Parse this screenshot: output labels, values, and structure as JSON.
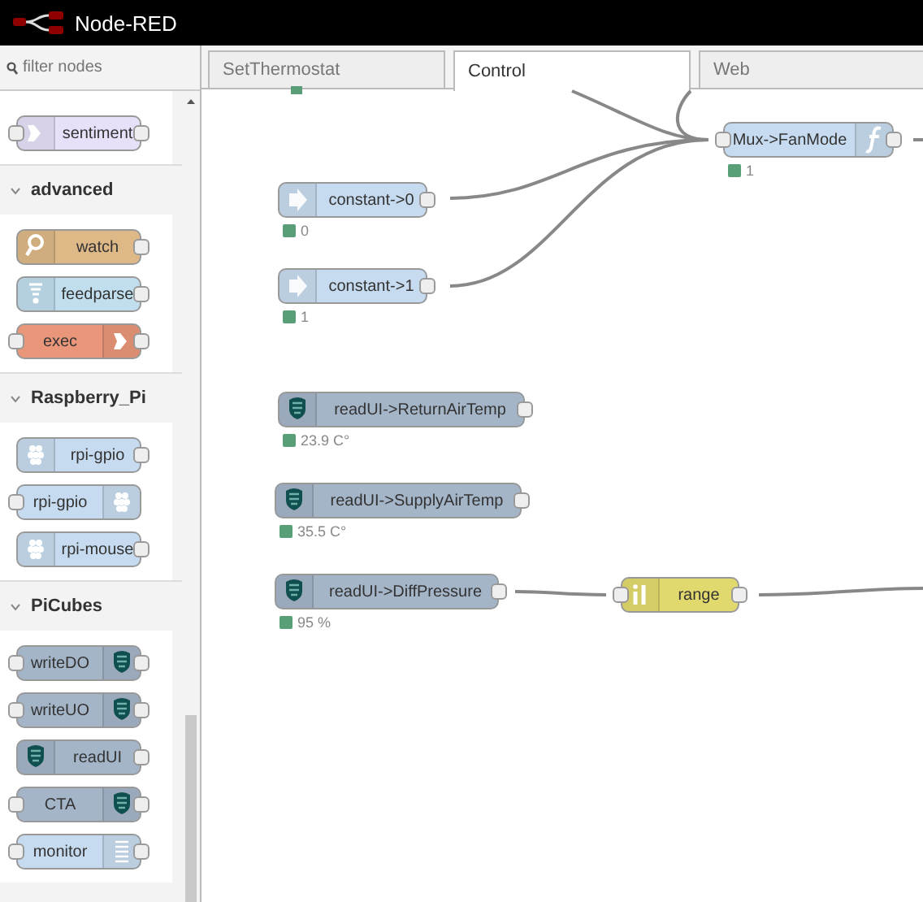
{
  "app": {
    "title": "Node-RED"
  },
  "palette": {
    "filter": {
      "placeholder": "filter nodes"
    },
    "categories": [
      {
        "kind": "tail",
        "nodes": [
          {
            "label": "sentiment",
            "color": "#e6e0f8",
            "inputs": true,
            "outputs": true
          }
        ]
      },
      {
        "name": "advanced",
        "kind": "full",
        "expanded": true,
        "nodes": [
          {
            "label": "watch",
            "color": "#deb887",
            "inputs": false,
            "outputs": true
          },
          {
            "label": "feedparse",
            "color": "#c0deed",
            "inputs": false,
            "outputs": true
          },
          {
            "label": "exec",
            "color": "#e9967a",
            "inputs": true,
            "outputs": true
          }
        ]
      },
      {
        "name": "Raspberry_Pi",
        "kind": "full",
        "expanded": true,
        "nodes": [
          {
            "label": "rpi-gpio",
            "color": "#c6dbef",
            "inputs": false,
            "outputs": true
          },
          {
            "label": "rpi-gpio",
            "color": "#c6dbef",
            "inputs": true,
            "outputs": false
          },
          {
            "label": "rpi-mouse",
            "color": "#c6dbef",
            "inputs": false,
            "outputs": true
          }
        ]
      },
      {
        "name": "PiCubes",
        "kind": "full",
        "expanded": true,
        "nodes": [
          {
            "label": "writeDO",
            "color": "#a4b5c8",
            "inputs": true,
            "outputs": true
          },
          {
            "label": "writeUO",
            "color": "#a4b5c8",
            "inputs": true,
            "outputs": true
          },
          {
            "label": "readUI",
            "color": "#a4b5c8",
            "inputs": false,
            "outputs": true
          },
          {
            "label": "CTA",
            "color": "#a4b5c8",
            "inputs": true,
            "outputs": true
          },
          {
            "label": "monitor",
            "color": "#c6dbef",
            "inputs": true,
            "outputs": true
          }
        ]
      }
    ]
  },
  "tabs": [
    {
      "label": "SetThermostat",
      "selected": false
    },
    {
      "label": "Control",
      "selected": true
    },
    {
      "label": "Web",
      "selected": false
    }
  ],
  "canvas": {
    "nodes": [
      {
        "label": "Mux->FanMode",
        "color": "#c6dbef",
        "inputs": true,
        "outputs": true,
        "status": "1"
      },
      {
        "label": "constant->0",
        "color": "#c6dbef",
        "inputs": false,
        "outputs": true,
        "status": "0"
      },
      {
        "label": "constant->1",
        "color": "#c6dbef",
        "inputs": false,
        "outputs": true,
        "status": "1"
      },
      {
        "label": "readUI->ReturnAirTemp",
        "color": "#a4b5c8",
        "inputs": false,
        "outputs": true,
        "status": "23.9 C°"
      },
      {
        "label": "readUI->SupplyAirTemp",
        "color": "#a4b5c8",
        "inputs": false,
        "outputs": true,
        "status": "35.5 C°"
      },
      {
        "label": "readUI->DiffPressure",
        "color": "#a4b5c8",
        "inputs": false,
        "outputs": true,
        "status": "95 %"
      },
      {
        "label": "range",
        "color": "#e2d96e",
        "inputs": true,
        "outputs": true
      }
    ]
  }
}
